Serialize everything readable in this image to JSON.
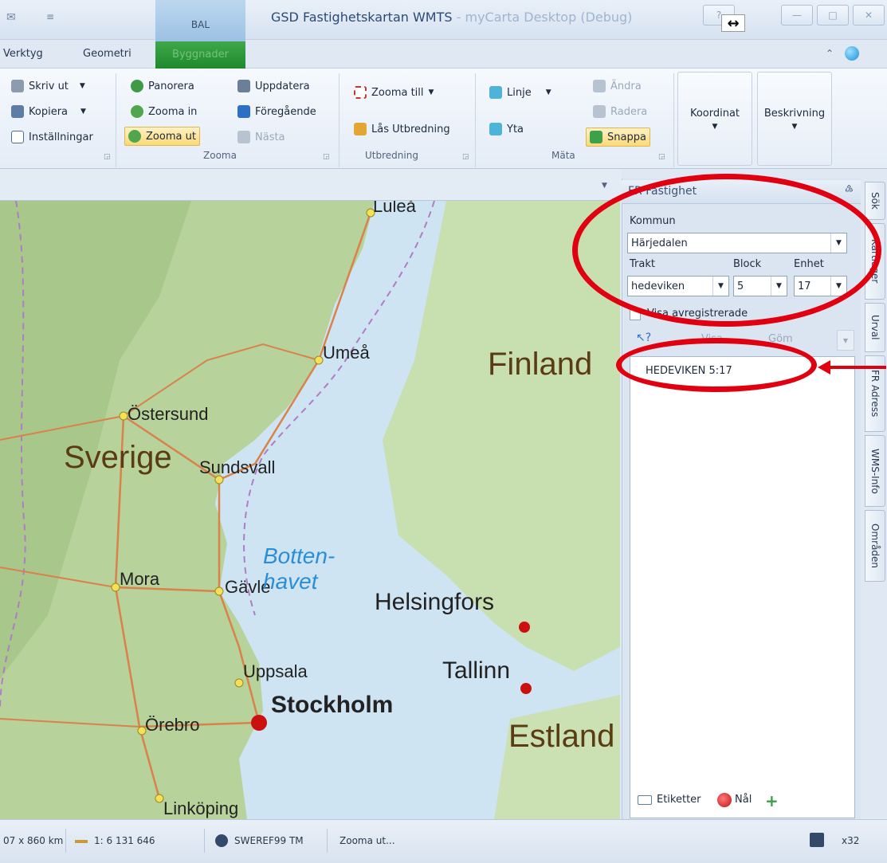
{
  "qat": {
    "icon_left": "✉",
    "more": "≡"
  },
  "contextual_tab_group": "BAL",
  "window": {
    "title": "GSD Fastighetskartan WMTS",
    "title_suffix": " - myCarta Desktop (Debug)",
    "minimize": "—",
    "maximize": "□",
    "close": "✕",
    "resize_cursor": "↔"
  },
  "tabs": [
    {
      "label": "Verktyg"
    },
    {
      "label": "Geometri"
    },
    {
      "label": "Byggnader"
    }
  ],
  "ribbon": {
    "print": {
      "skriv_ut": "Skriv ut",
      "kopiera": "Kopiera",
      "installningar": "Inställningar"
    },
    "zooma": {
      "label": "Zooma",
      "panorera": "Panorera",
      "zooma_in": "Zooma in",
      "zooma_ut": "Zooma ut",
      "uppdatera": "Uppdatera",
      "foregaende": "Föregående",
      "nasta": "Nästa"
    },
    "utbredning": {
      "label": "Utbredning",
      "zooma_till": "Zooma till",
      "las_utbredning": "Lås Utbredning"
    },
    "mata": {
      "label": "Mäta",
      "linje": "Linje",
      "yta": "Yta",
      "andra": "Ändra",
      "radera": "Radera",
      "snappa": "Snappa"
    },
    "koordinat": "Koordinat",
    "beskrivning": "Beskrivning"
  },
  "map": {
    "cities": [
      "Luleå",
      "Umeå",
      "Östersund",
      "Sundsvall",
      "Mora",
      "Gävle",
      "Uppsala",
      "Stockholm",
      "Örebro",
      "Linköping",
      "Helsingfors",
      "Tallinn"
    ],
    "countries": [
      "Sverige",
      "Finland",
      "Estland"
    ],
    "sea_line1": "Botten-",
    "sea_line2": "havet"
  },
  "panel": {
    "title": "FR Fastighet",
    "pin_icon": "♵",
    "kommun_label": "Kommun",
    "kommun_value": "Härjedalen",
    "trakt_label": "Trakt",
    "block_label": "Block",
    "enhet_label": "Enhet",
    "trakt_value": "hedeviken",
    "block_value": "5",
    "enhet_value": "17",
    "checkbox_label": "Visa avregistrerade",
    "visa": "Visa",
    "gom": "Göm",
    "results": [
      "HEDEVIKEN 5:17"
    ],
    "etiketter": "Etiketter",
    "nal": "Nål"
  },
  "side_tabs": [
    "Sök",
    "Kartlager",
    "Urval",
    "FR Adress",
    "WMS-Info",
    "Områden"
  ],
  "status": {
    "extent": "07 x 860 km",
    "scale": "1: 6 131 646",
    "crs": "SWEREF99 TM",
    "message": "Zooma ut...",
    "zoom": "x32"
  },
  "colors": {
    "annotation": "#e00010",
    "contextual_tab": "#2a9a38",
    "selected_button": "#fbd978"
  }
}
